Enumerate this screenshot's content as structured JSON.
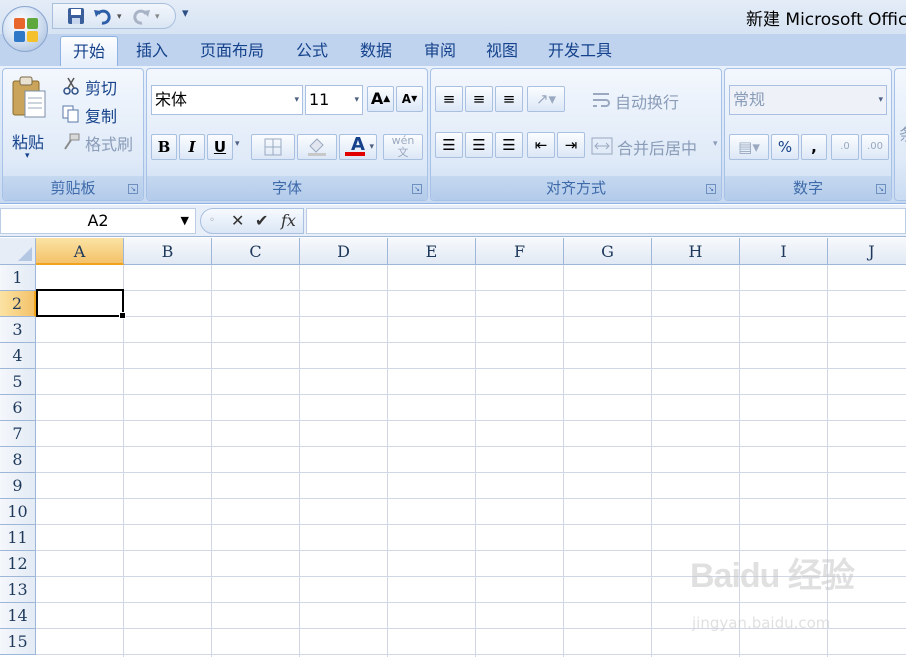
{
  "window": {
    "title": "新建 Microsoft Offic"
  },
  "quick_access": {
    "save_icon": "save-icon",
    "undo_icon": "undo-icon",
    "redo_icon": "redo-icon",
    "customize_icon": "customize-qat-icon"
  },
  "tabs": [
    "开始",
    "插入",
    "页面布局",
    "公式",
    "数据",
    "审阅",
    "视图",
    "开发工具"
  ],
  "active_tab": "开始",
  "ribbon": {
    "clipboard": {
      "label": "剪贴板",
      "paste": "粘贴",
      "cut": "剪切",
      "copy": "复制",
      "format_painter": "格式刷"
    },
    "font": {
      "label": "字体",
      "font_name": "宋体",
      "font_size": "11",
      "bold": "B",
      "italic": "I",
      "underline": "U",
      "font_color_letter": "A",
      "phonetic": "wén"
    },
    "alignment": {
      "label": "对齐方式",
      "wrap_text": "自动换行",
      "merge_center": "合并后居中"
    },
    "number": {
      "label": "数字",
      "format": "常规",
      "percent": "%",
      "comma": ",",
      "inc_decimal": ".0",
      "dec_decimal": ".00"
    },
    "next_group_partial": "条"
  },
  "formula_bar": {
    "name_box": "A2",
    "cancel": "✕",
    "enter": "✔",
    "fx": "fx",
    "value": ""
  },
  "grid": {
    "columns": [
      "A",
      "B",
      "C",
      "D",
      "E",
      "F",
      "G",
      "H",
      "I",
      "J"
    ],
    "rows": [
      "1",
      "2",
      "3",
      "4",
      "5",
      "6",
      "7",
      "8",
      "9",
      "10",
      "11",
      "12",
      "13",
      "14",
      "15"
    ],
    "selected_column": "A",
    "selected_row": "2"
  },
  "watermark": {
    "top": "Baidu 经验",
    "bottom": "jingyan.baidu.com"
  },
  "colors": {
    "ribbon": "#d7e5f6",
    "selection_header": "#f4c26a",
    "gridline": "#d0d7e5",
    "font_color_underline": "#e00000"
  }
}
